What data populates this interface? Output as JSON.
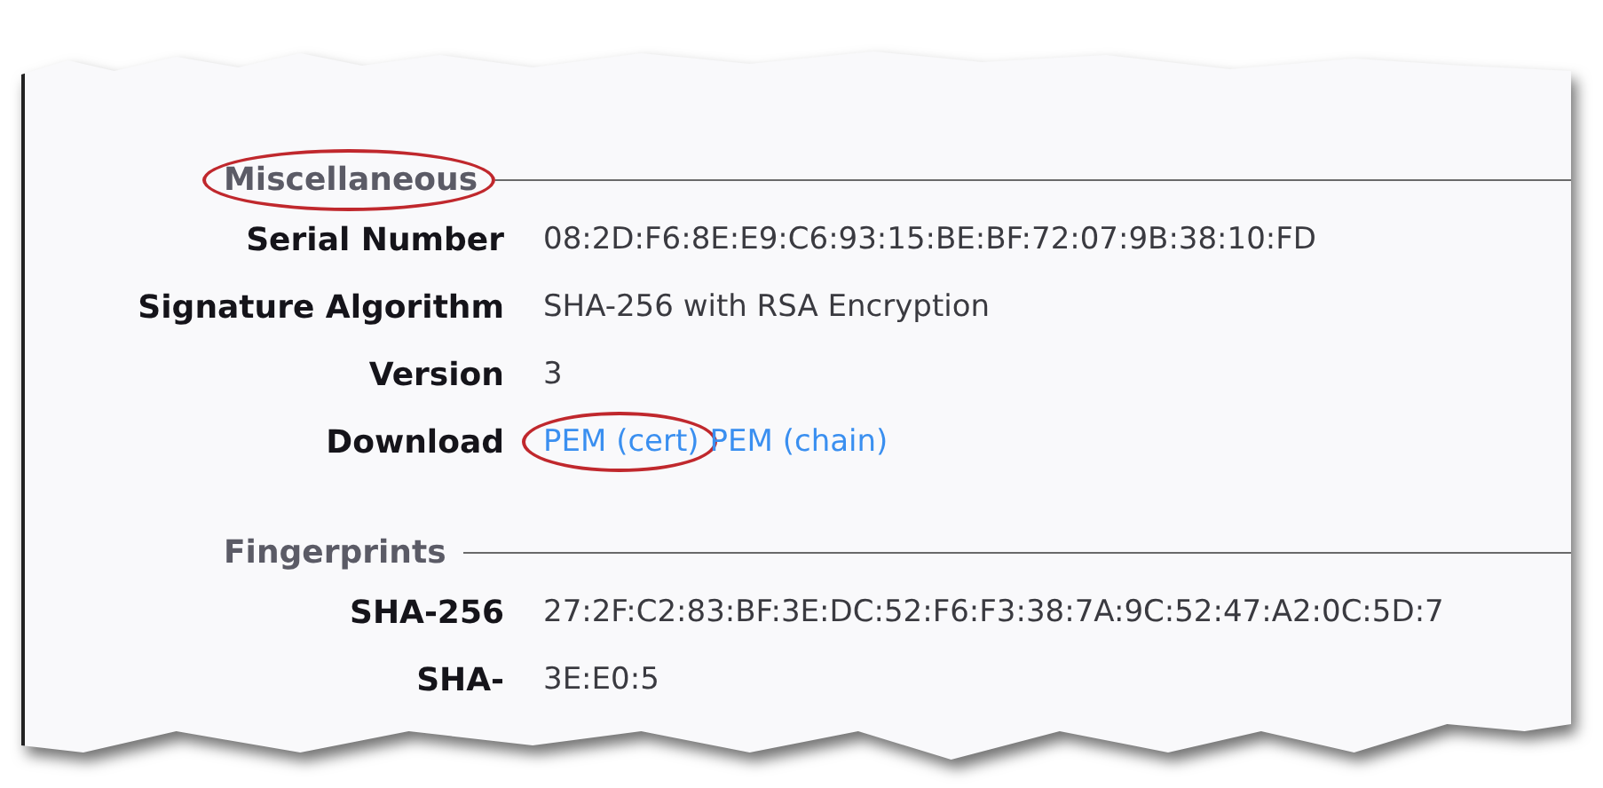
{
  "sections": [
    {
      "title": "Miscellaneous",
      "highlighted": true,
      "rows": [
        {
          "label": "Serial Number",
          "kind": "text",
          "value": "08:2D:F6:8E:E9:C6:93:15:BE:BF:72:07:9B:38:10:FD"
        },
        {
          "label": "Signature Algorithm",
          "kind": "text",
          "value": "SHA-256 with RSA Encryption"
        },
        {
          "label": "Version",
          "kind": "text",
          "value": "3"
        },
        {
          "label": "Download",
          "kind": "links",
          "links": [
            {
              "text": "PEM (cert)",
              "highlighted": true
            },
            {
              "text": "PEM (chain)",
              "highlighted": false
            }
          ]
        }
      ]
    },
    {
      "title": "Fingerprints",
      "highlighted": false,
      "rows": [
        {
          "label": "SHA-256",
          "kind": "text",
          "value": "27:2F:C2:83:BF:3E:DC:52:F6:F3:38:7A:9C:52:47:A2:0C:5D:7"
        },
        {
          "label": "SHA-",
          "kind": "text",
          "value": "3E:E0:5"
        }
      ]
    }
  ]
}
